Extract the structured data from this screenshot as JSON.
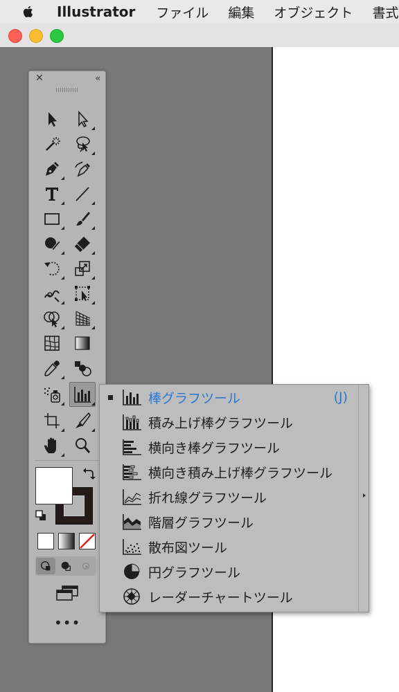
{
  "menubar": {
    "app_name": "Illustrator",
    "menus": [
      "ファイル",
      "編集",
      "オブジェクト",
      "書式"
    ]
  },
  "window": {
    "traffic_lights": [
      "close",
      "minimize",
      "zoom"
    ]
  },
  "tools_panel": {
    "close_glyph": "✕",
    "collapse_glyph": "‹‹",
    "more_glyph": "•••",
    "active_tool": "bar-graph-tool",
    "fill_color": "#ffffff",
    "stroke_color": "#241b18"
  },
  "flyout": {
    "items": [
      {
        "label": "棒グラフツール",
        "shortcut": "(J)",
        "selected": true,
        "icon": "bar-graph-icon"
      },
      {
        "label": "積み上げ棒グラフツール",
        "selected": false,
        "icon": "stacked-bar-graph-icon"
      },
      {
        "label": "横向き棒グラフツール",
        "selected": false,
        "icon": "horizontal-bar-graph-icon"
      },
      {
        "label": "横向き積み上げ棒グラフツール",
        "selected": false,
        "icon": "stacked-horizontal-bar-graph-icon"
      },
      {
        "label": "折れ線グラフツール",
        "selected": false,
        "icon": "line-graph-icon"
      },
      {
        "label": "階層グラフツール",
        "selected": false,
        "icon": "area-graph-icon"
      },
      {
        "label": "散布図ツール",
        "selected": false,
        "icon": "scatter-graph-icon"
      },
      {
        "label": "円グラフツール",
        "selected": false,
        "icon": "pie-graph-icon"
      },
      {
        "label": "レーダーチャートツール",
        "selected": false,
        "icon": "radar-graph-icon"
      }
    ],
    "selected_color": "#2a78d4"
  }
}
